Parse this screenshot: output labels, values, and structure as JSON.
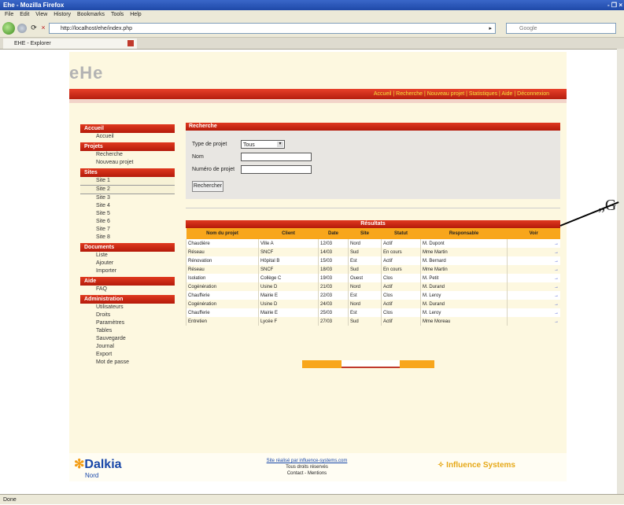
{
  "browser": {
    "title": "Ehe - Mozilla Firefox",
    "window_controls": "- ❐ ×",
    "menu": [
      "File",
      "Edit",
      "View",
      "History",
      "Bookmarks",
      "Tools",
      "Help"
    ],
    "address": "http://localhost/ehe/index.php",
    "search_placeholder": "Google",
    "tab_label": "EHE - Explorer",
    "status": "Done"
  },
  "page": {
    "logo": "eHe",
    "topnav": "Accueil | Recherche | Nouveau projet | Statistiques | Aide | Déconnexion"
  },
  "sidebar": [
    {
      "head": "Accueil",
      "items": [
        "Accueil"
      ]
    },
    {
      "head": "Projets",
      "items": [
        "Recherche",
        "Nouveau projet"
      ]
    },
    {
      "head": "Sites",
      "items": [
        "Site 1",
        "Site 2",
        "Site 3",
        "Site 4",
        "Site 5",
        "Site 6",
        "Site 7",
        "Site 8"
      ]
    },
    {
      "head": "Documents",
      "items": [
        "Liste",
        "Ajouter",
        "Importer"
      ]
    },
    {
      "head": "Aide",
      "items": [
        "FAQ"
      ]
    },
    {
      "head": "Administration",
      "items": [
        "Utilisateurs",
        "Droits",
        "Paramètres",
        "Tables",
        "Sauvegarde",
        "Journal",
        "Export",
        "Mot de passe"
      ]
    }
  ],
  "search": {
    "title": "Recherche",
    "label_type": "Type de projet",
    "select_value": "Tous",
    "label_name": "Nom",
    "label_number": "Numéro de projet",
    "button": "Rechercher"
  },
  "results": {
    "title": "Résultats",
    "headers": [
      "Nom du projet",
      "Client",
      "Date",
      "Site",
      "Statut",
      "Responsable",
      "Voir"
    ],
    "rows": [
      [
        "Chaudière",
        "Ville A",
        "12/03",
        "Nord",
        "Actif",
        "M. Dupont",
        "→"
      ],
      [
        "Réseau",
        "SNCF",
        "14/03",
        "Sud",
        "En cours",
        "Mme Martin",
        "→"
      ],
      [
        "Rénovation",
        "Hôpital B",
        "15/03",
        "Est",
        "Actif",
        "M. Bernard",
        "→"
      ],
      [
        "Réseau",
        "SNCF",
        "18/03",
        "Sud",
        "En cours",
        "Mme Martin",
        "→"
      ],
      [
        "Isolation",
        "Collège C",
        "19/03",
        "Ouest",
        "Clos",
        "M. Petit",
        "→"
      ],
      [
        "Cogénération",
        "Usine D",
        "21/03",
        "Nord",
        "Actif",
        "M. Durand",
        "→"
      ],
      [
        "Chaufferie",
        "Mairie E",
        "22/03",
        "Est",
        "Clos",
        "M. Leroy",
        "→"
      ],
      [
        "Cogénération",
        "Usine D",
        "24/03",
        "Nord",
        "Actif",
        "M. Durand",
        "→"
      ],
      [
        "Chaufferie",
        "Mairie E",
        "25/03",
        "Est",
        "Clos",
        "M. Leroy",
        "→"
      ],
      [
        "Entretien",
        "Lycée F",
        "27/03",
        "Sud",
        "Actif",
        "Mme Moreau",
        "→"
      ]
    ]
  },
  "footer": {
    "brand": "Dalkia",
    "brand_sub": "Nord",
    "line1": "Site réalisé par influence-systems.com",
    "line2": "Tous droits réservés",
    "line3": "Contact - Mentions",
    "influence": "Influence Systems"
  },
  "annotation": {
    "label": "„G"
  }
}
